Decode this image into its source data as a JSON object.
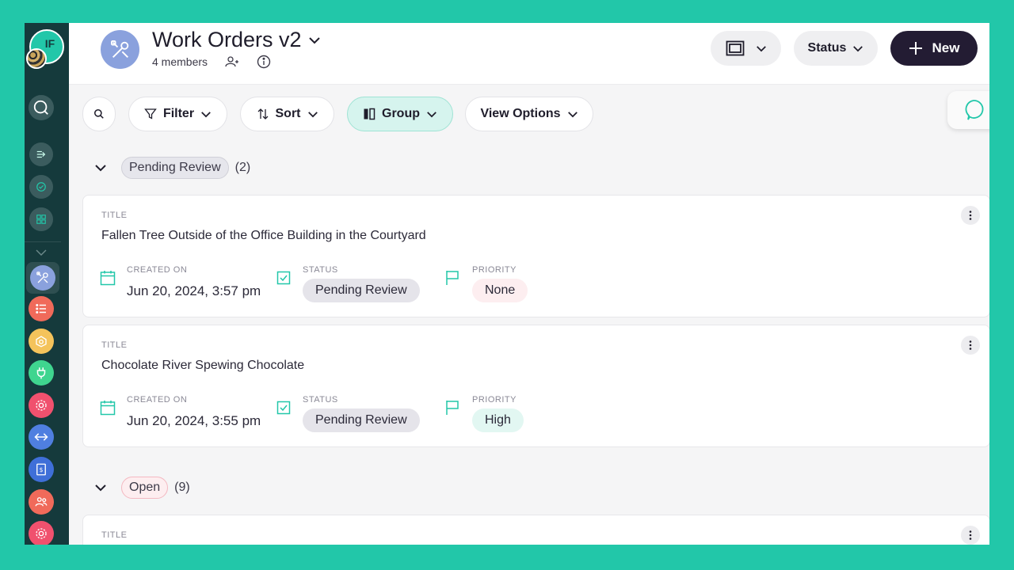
{
  "sidebar": {
    "avatar_initials": "IF",
    "colors": {
      "bg": "#153a3c"
    },
    "apps": [
      {
        "name": "work-orders",
        "color": "#8aa1dd",
        "active": true
      },
      {
        "name": "list",
        "color": "#f06a5a"
      },
      {
        "name": "inventory",
        "color": "#f4c35b"
      },
      {
        "name": "plug",
        "color": "#3fd58f"
      },
      {
        "name": "settings-pink",
        "color": "#f0516e"
      },
      {
        "name": "transfer",
        "color": "#4f7fe0"
      },
      {
        "name": "billing",
        "color": "#3f6fd8"
      },
      {
        "name": "team",
        "color": "#f06a5a"
      },
      {
        "name": "settings-pink-2",
        "color": "#f0516e"
      }
    ]
  },
  "header": {
    "title": "Work Orders v2",
    "members": "4 members",
    "status_label": "Status",
    "new_label": "New"
  },
  "toolbar": {
    "filter": "Filter",
    "sort": "Sort",
    "group": "Group",
    "view_options": "View Options"
  },
  "groups": [
    {
      "label": "Pending Review",
      "count": "(2)",
      "cards": [
        {
          "title_label": "TITLE",
          "title": "Fallen Tree Outside of the Office Building in the Courtyard",
          "created_label": "CREATED ON",
          "created": "Jun 20, 2024, 3:57 pm",
          "status_label": "STATUS",
          "status": "Pending Review",
          "priority_label": "PRIORITY",
          "priority": "None"
        },
        {
          "title_label": "TITLE",
          "title": "Chocolate River Spewing Chocolate",
          "created_label": "CREATED ON",
          "created": "Jun 20, 2024, 3:55 pm",
          "status_label": "STATUS",
          "status": "Pending Review",
          "priority_label": "PRIORITY",
          "priority": "High"
        }
      ]
    },
    {
      "label": "Open",
      "count": "(9)",
      "cards": [
        {
          "title_label": "TITLE"
        }
      ]
    }
  ],
  "colors": {
    "accent": "#22c7a9",
    "new_button": "#231c33"
  }
}
